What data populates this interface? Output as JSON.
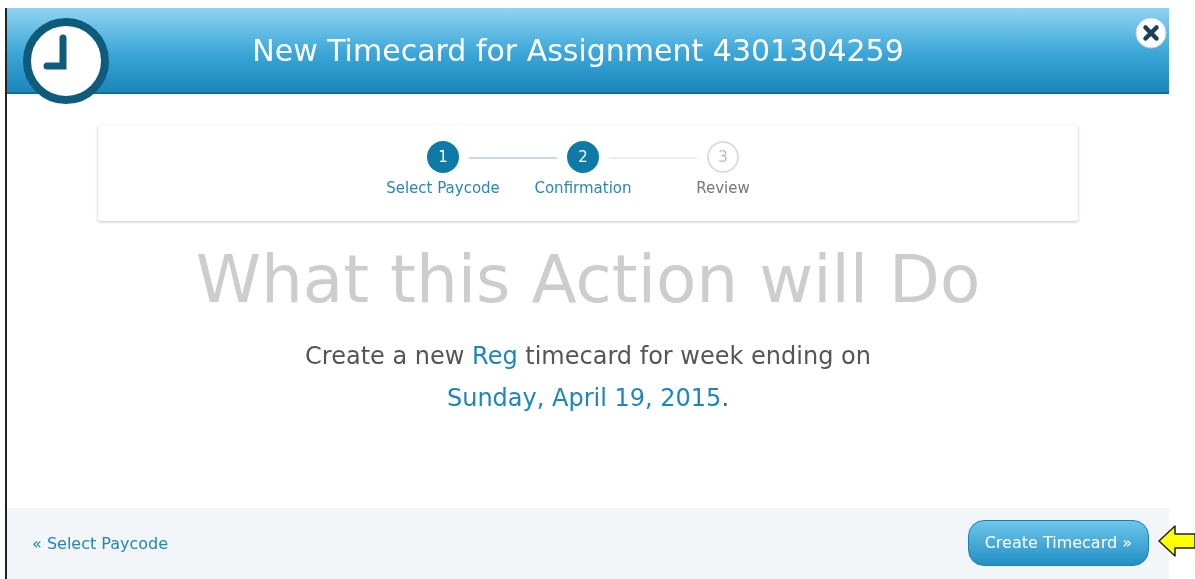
{
  "dialog": {
    "title": "New Timecard for Assignment 4301304259"
  },
  "steps": [
    {
      "number": "1",
      "label": "Select Paycode",
      "reached": true
    },
    {
      "number": "2",
      "label": "Confirmation",
      "reached": true
    },
    {
      "number": "3",
      "label": "Review",
      "reached": false
    }
  ],
  "heading": "What this Action will Do",
  "message_lines": [
    [
      {
        "text": "Create a new ",
        "highlight": false
      },
      {
        "text": "Reg",
        "highlight": true
      },
      {
        "text": " timecard for week ending on",
        "highlight": false
      }
    ],
    [
      {
        "text": "Sunday, April 19, 2015",
        "highlight": true
      },
      {
        "text": ".",
        "highlight": false
      }
    ]
  ],
  "footer": {
    "back_link": "« Select Paycode",
    "primary_button": "Create Timecard »"
  }
}
